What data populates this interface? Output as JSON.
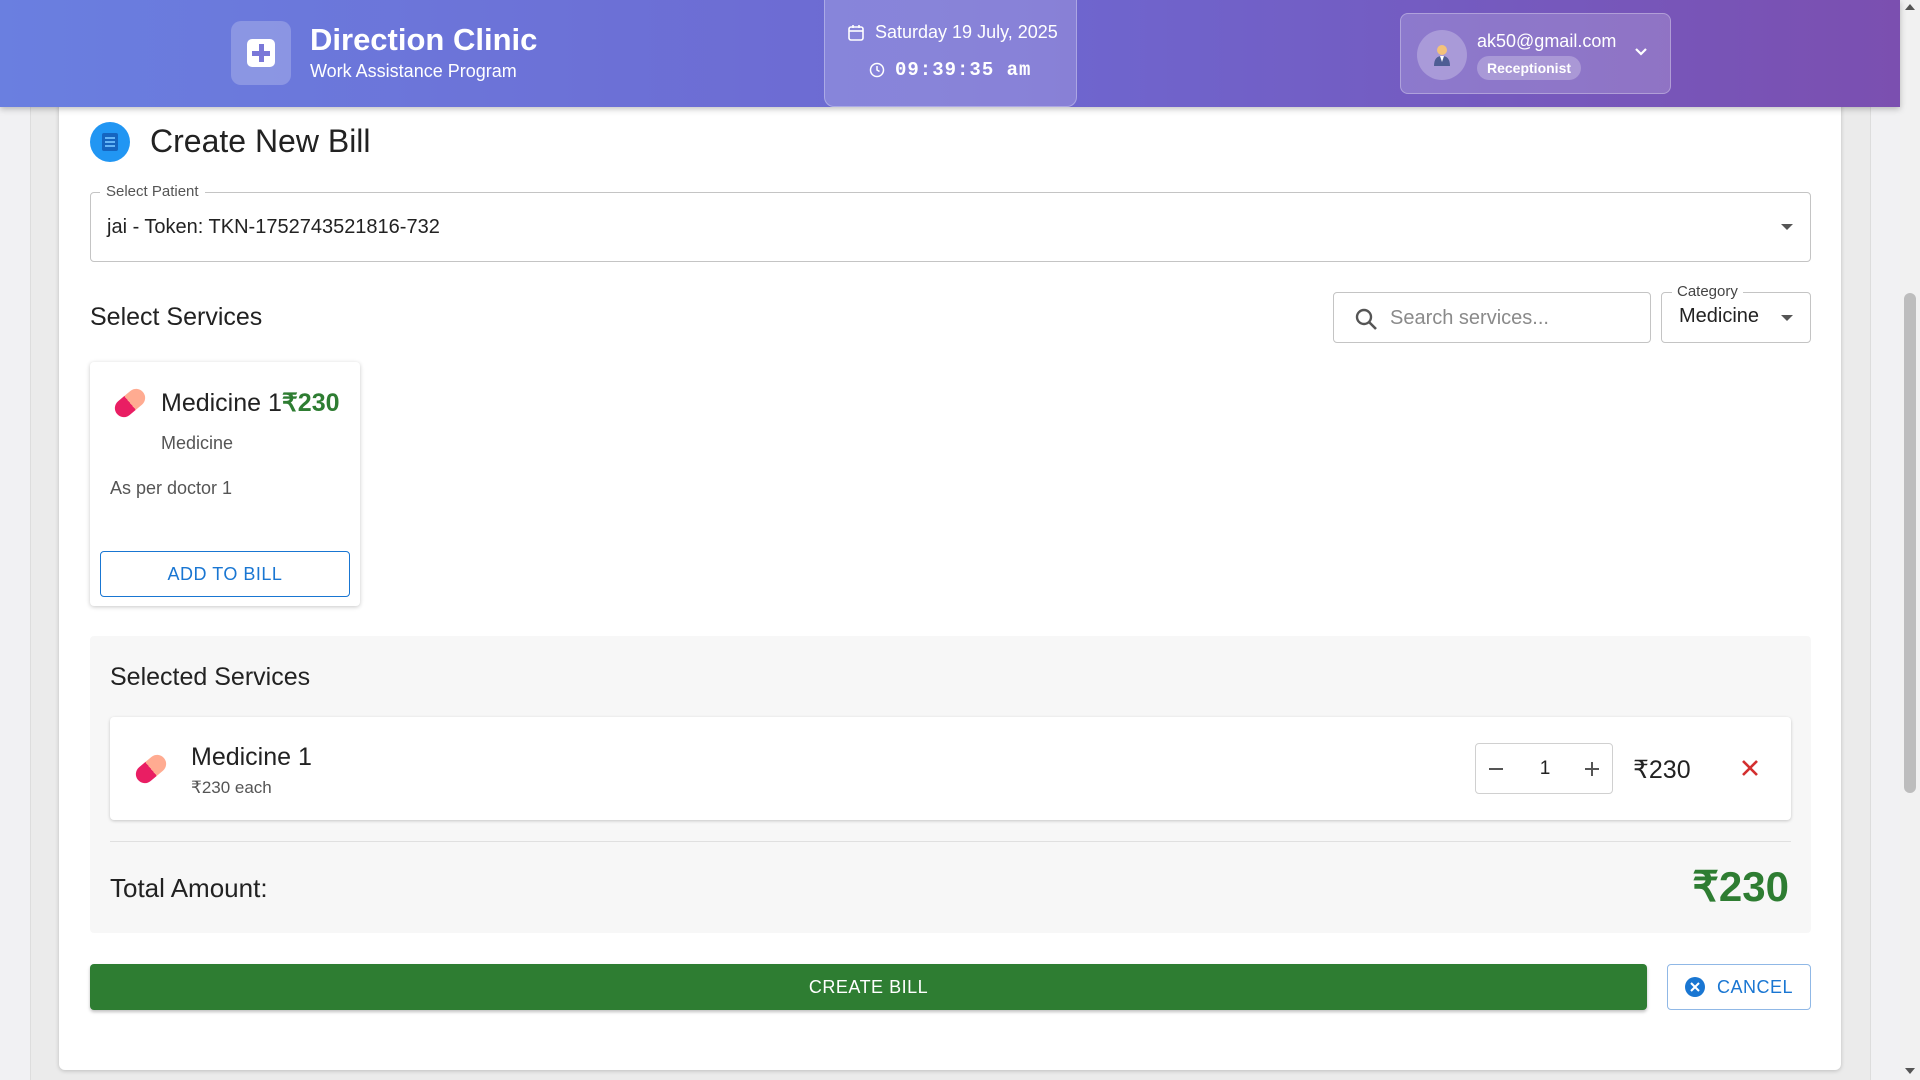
{
  "header": {
    "brand_title": "Direction Clinic",
    "brand_subtitle": "Work Assistance Program",
    "date": "Saturday 19 July, 2025",
    "time": "09:39:35 am",
    "user_email": "ak50@gmail.com",
    "user_role": "Receptionist",
    "icons": [
      "medical-cross-icon",
      "calendar-icon",
      "clock-icon",
      "user-avatar-icon",
      "chevron-down-icon"
    ]
  },
  "page": {
    "title": "Create New Bill"
  },
  "patient": {
    "label": "Select Patient",
    "value": "jai - Token: TKN-1752743521816-732"
  },
  "services": {
    "heading": "Select Services",
    "search_placeholder": "Search services...",
    "category_label": "Category",
    "category_value": "Medicine",
    "items": [
      {
        "name": "Medicine 1",
        "price": "₹230",
        "category": "Medicine",
        "description": "As per doctor 1",
        "button": "ADD TO BILL"
      }
    ]
  },
  "selected": {
    "heading": "Selected Services",
    "items": [
      {
        "name": "Medicine 1",
        "each": "₹230 each",
        "quantity": "1",
        "line_total": "₹230"
      }
    ],
    "total_label": "Total Amount:",
    "total_value": "₹230"
  },
  "actions": {
    "create": "CREATE BILL",
    "cancel": "CANCEL"
  },
  "colors": {
    "header_gradient_start": "#6a7fe0",
    "header_gradient_end": "#7b4fb0",
    "primary": "#1976d2",
    "success": "#2e7d32",
    "danger": "#d32f2f"
  }
}
